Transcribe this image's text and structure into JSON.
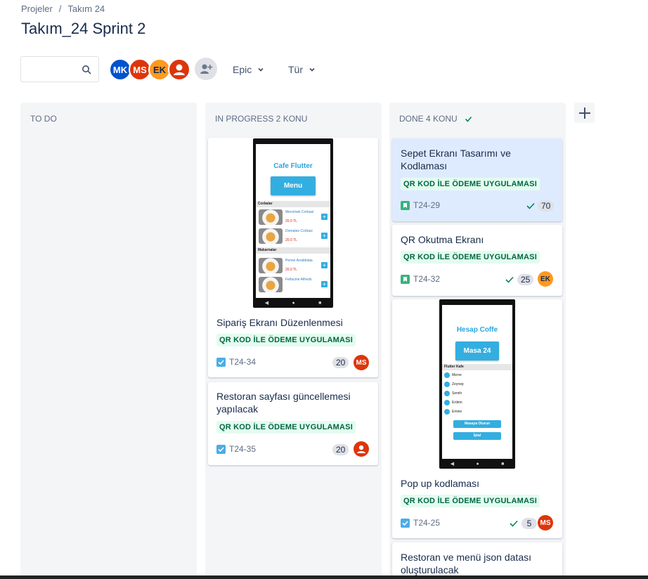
{
  "breadcrumb": {
    "root": "Projeler",
    "separator": "/",
    "project": "Takım 24"
  },
  "page_title": "Takım_24 Sprint 2",
  "toolbar": {
    "search_placeholder": "",
    "avatars": [
      {
        "initials": "MK",
        "color": "#0052cc"
      },
      {
        "initials": "MS",
        "color": "#de350b"
      },
      {
        "initials": "EK",
        "color": "#ff991f"
      }
    ],
    "filters": {
      "epic": "Epic",
      "type": "Tür"
    }
  },
  "columns": {
    "todo": {
      "title": "TO DO"
    },
    "in_progress": {
      "title": "IN PROGRESS 2 KONU"
    },
    "done": {
      "title": "DONE 4 KONU"
    }
  },
  "epic_label": "QR KOD İLE ÖDEME UYGULAMASI",
  "cards": {
    "c1": {
      "title": "Sipariş Ekranı Düzenlenmesi",
      "key": "T24-34",
      "points": "20",
      "assignee": "MS"
    },
    "c2": {
      "title": "Restoran sayfası güncellemesi yapılacak",
      "key": "T24-35",
      "points": "20"
    },
    "d1": {
      "title": "Sepet Ekranı Tasarımı ve Kodlaması",
      "key": "T24-29",
      "points": "70"
    },
    "d2": {
      "title": "QR Okutma Ekranı",
      "key": "T24-32",
      "points": "25",
      "assignee": "EK"
    },
    "d3": {
      "title": "Pop up kodlaması",
      "key": "T24-25",
      "points": "5",
      "assignee": "MS"
    },
    "d4": {
      "title": "Restoran ve menü json datası oluşturulacak"
    }
  },
  "phone1": {
    "app_title": "Cafe Flutter",
    "button": "Menu",
    "section1": "Corbalar",
    "section2": "Makarnalar",
    "items": [
      {
        "name": "Mercimek Corbasi",
        "price": "20.0 TL"
      },
      {
        "name": "Domates Corbasi",
        "price": "20.0 TL"
      },
      {
        "name": "Penne Arrabbiata",
        "price": "20.0 TL"
      },
      {
        "name": "Fettucine Alfredo",
        "price": ""
      }
    ]
  },
  "phone2": {
    "app_title": "Hesap Coffe",
    "button": "Masa 24",
    "section": "Flutter Kafe",
    "people": [
      "Merve",
      "Zeynep",
      "Semih",
      "Erdem",
      "Emine"
    ],
    "btn_join": "Masaya Oturun",
    "btn_cancel": "İptal"
  },
  "colors": {
    "epic_bg": "#e3fcef",
    "epic_text": "#006644",
    "story_icon": "#36b37e",
    "task_icon": "#4bade8",
    "selected_card": "#deebff"
  }
}
